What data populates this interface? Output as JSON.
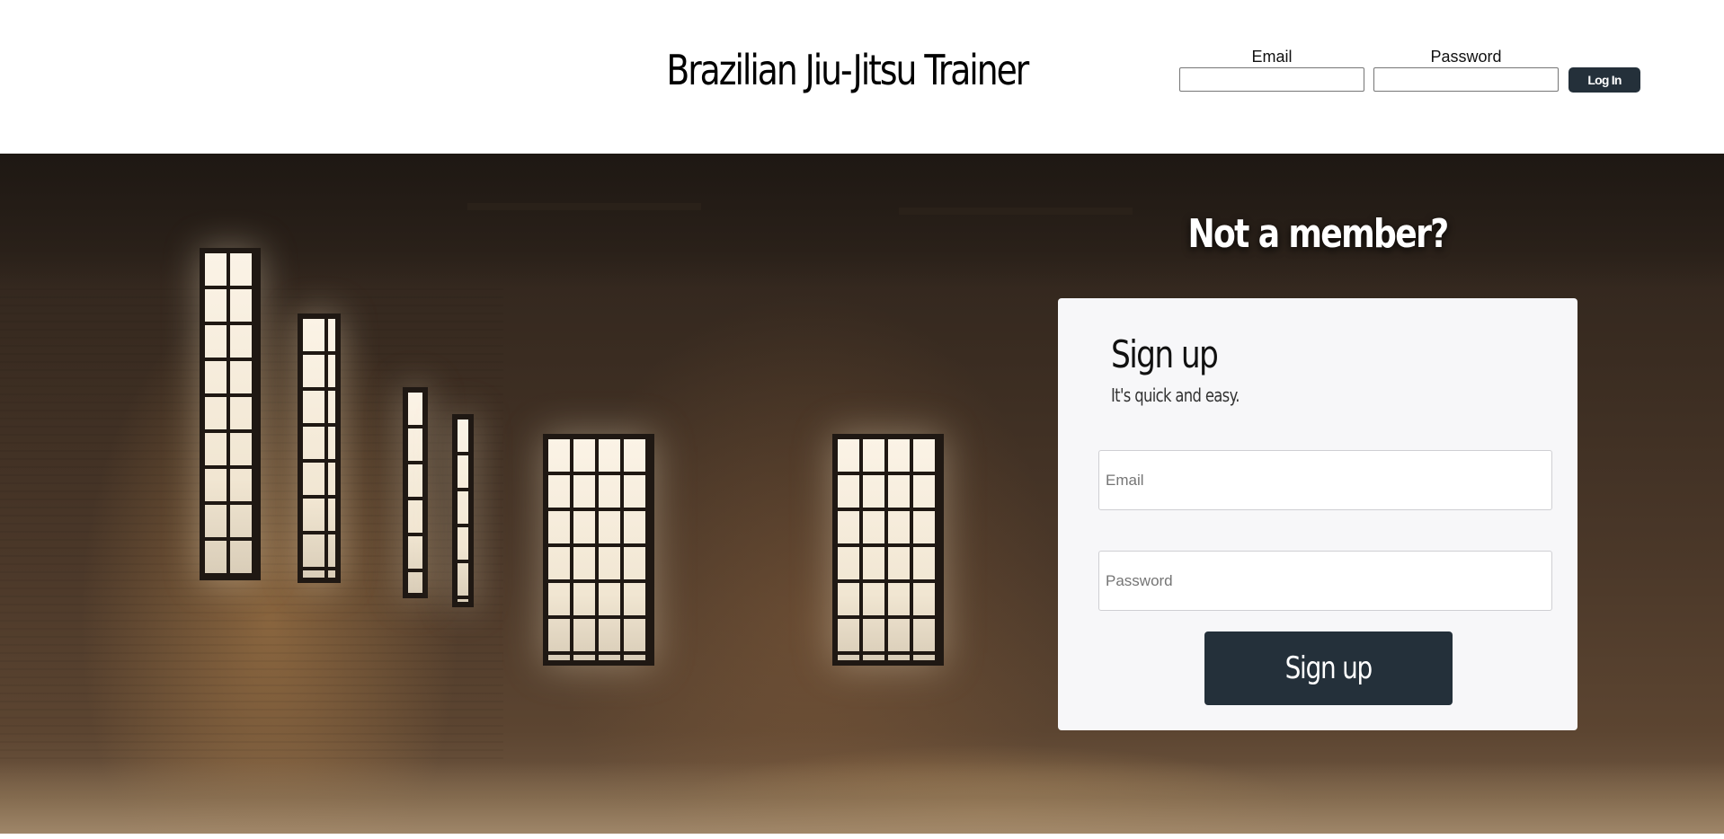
{
  "header": {
    "title": "Brazilian Jiu-Jitsu Trainer",
    "login": {
      "email_label": "Email",
      "password_label": "Password",
      "button_label": "Log In"
    }
  },
  "hero": {
    "heading": "Not a member?",
    "signup": {
      "title": "Sign up",
      "subtitle": "It's quick and easy.",
      "email_placeholder": "Email",
      "password_placeholder": "Password",
      "button_label": "Sign up"
    }
  },
  "colors": {
    "button_bg": "#24303a",
    "card_bg": "#f7f7f9",
    "header_bg": "#ffffff"
  }
}
